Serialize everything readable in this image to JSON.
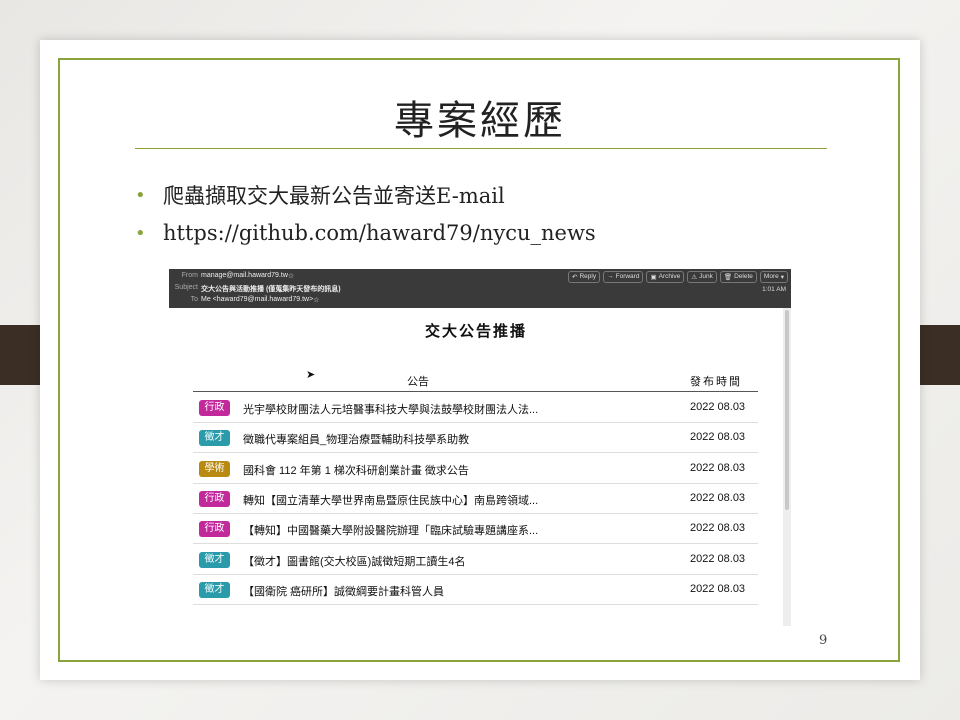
{
  "slide": {
    "title": "專案經歷",
    "bullets": [
      "爬蟲擷取交大最新公告並寄送E-mail",
      "https://github.com/haward79/nycu_news"
    ],
    "page_number": "9"
  },
  "email": {
    "from_label": "From",
    "from_value": "manage@mail.haward79.tw",
    "subject_label": "Subject",
    "subject_value": "交大公告與活動推播 (僅蒐集昨天發布的訊息)",
    "to_label": "To",
    "to_value": "Me <haward79@mail.haward79.tw>",
    "time": "1:01 AM",
    "buttons": [
      "Reply",
      "Forward",
      "Archive",
      "Junk",
      "Delete",
      "More"
    ],
    "heading": "交大公告推播",
    "col_notice": "公告",
    "col_date": "發布時間",
    "rows": [
      {
        "tag": "行政",
        "color": "#c22a9b",
        "text": "光宇學校財團法人元培醫事科技大學與法鼓學校財團法人法...",
        "date": "2022 08.03"
      },
      {
        "tag": "徵才",
        "color": "#2a9bab",
        "text": "徵職代專案組員_物理治療暨輔助科技學系助教",
        "date": "2022 08.03"
      },
      {
        "tag": "學術",
        "color": "#b88a12",
        "text": "國科會 112 年第 1 梯次科研創業計畫 徵求公告",
        "date": "2022 08.03"
      },
      {
        "tag": "行政",
        "color": "#c22a9b",
        "text": "轉知【國立清華大學世界南島暨原住民族中心】南島跨領域...",
        "date": "2022 08.03"
      },
      {
        "tag": "行政",
        "color": "#c22a9b",
        "text": "【轉知】中國醫藥大學附設醫院辦理「臨床試驗專題講座系...",
        "date": "2022 08.03"
      },
      {
        "tag": "徵才",
        "color": "#2a9bab",
        "text": "【徵才】圖書館(交大校區)誠徵短期工讀生4名",
        "date": "2022 08.03"
      },
      {
        "tag": "徵才",
        "color": "#2a9bab",
        "text": "【國衛院 癌研所】誠徵綱要計畫科管人員",
        "date": "2022 08.03"
      }
    ]
  }
}
